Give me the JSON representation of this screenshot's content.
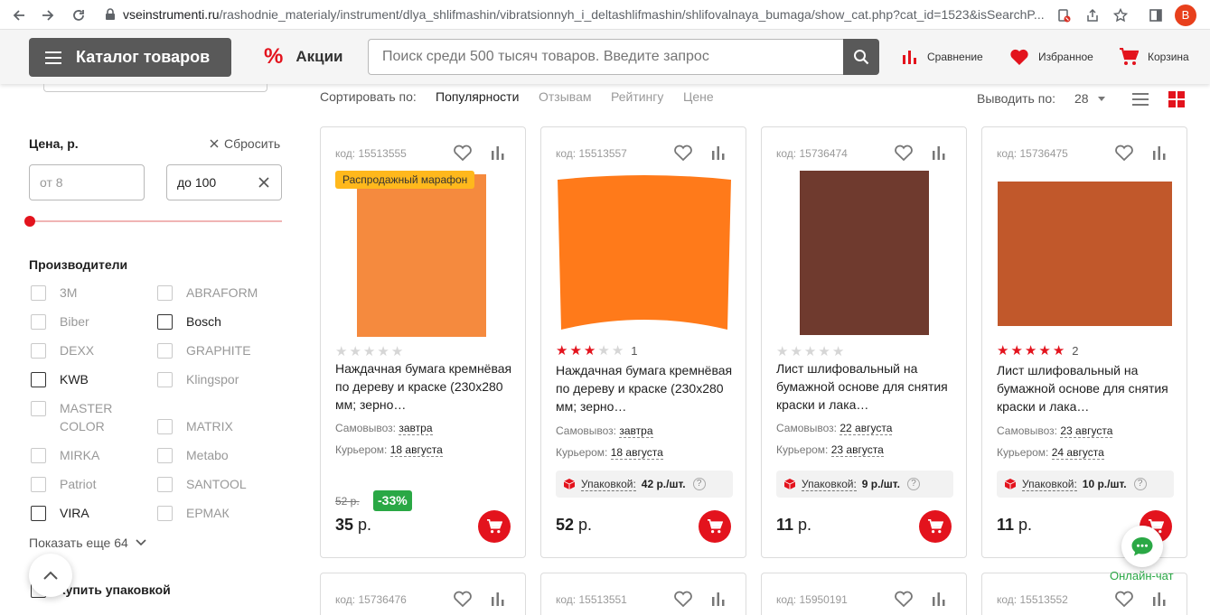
{
  "browser": {
    "url_host": "vseinstrumenti.ru",
    "url_path": "/rashodnie_materialy/instrument/dlya_shlifmashin/vibratsionnyh_i_deltashlifmashin/shlifovalnaya_bumaga/show_cat.php?cat_id=1523&isSearchP...",
    "avatar_letter": "B"
  },
  "header": {
    "catalog_label": "Каталог товаров",
    "promo_label": "Акции",
    "search_placeholder": "Поиск среди 500 тысяч товаров. Введите запрос",
    "compare_label": "Сравнение",
    "favorites_label": "Избранное",
    "cart_label": "Корзина"
  },
  "filters": {
    "price_title": "Цена, р.",
    "reset_label": "Сбросить",
    "price_from_placeholder": "от 8",
    "price_to_value": "до 100",
    "manufacturers_title": "Производители",
    "brands": [
      "3M",
      "ABRAFORM",
      "Biber",
      "Bosch",
      "DEXX",
      "GRAPHITE",
      "KWB",
      "Klingspor",
      "MASTER COLOR",
      "MATRIX",
      "MIRKA",
      "Metabo",
      "Patriot",
      "SANTOOL",
      "VIRA",
      "ЕРМАК"
    ],
    "show_more_label": "Показать еще 64",
    "buy_by_pack_label": "Купить упаковкой"
  },
  "sort": {
    "label": "Сортировать по:",
    "options": [
      "Популярности",
      "Отзывам",
      "Рейтингу",
      "Цене"
    ],
    "per_page_label": "Выводить по:",
    "per_page_value": "28"
  },
  "products": [
    {
      "code": "код: 15513555",
      "badge": "Распродажный марафон",
      "rating": 0,
      "reviews": "",
      "title": "Наждачная бумага кремнёвая по дереву и краске (230х280 мм; зерно…",
      "pickup_label": "Самовывоз:",
      "pickup_date": "завтра",
      "courier_label": "Курьером:",
      "courier_date": "18 августа",
      "old_price": "52 р.",
      "discount": "-33%",
      "price": "35",
      "currency": "р."
    },
    {
      "code": "код: 15513557",
      "rating": 3,
      "reviews": "1",
      "title": "Наждачная бумага кремнёвая по дереву и краске (230х280 мм; зерно…",
      "pickup_label": "Самовывоз:",
      "pickup_date": "завтра",
      "courier_label": "Курьером:",
      "courier_date": "18 августа",
      "pack_label": "Упаковкой:",
      "pack_price": "42 р./шт.",
      "price": "52",
      "currency": "р."
    },
    {
      "code": "код: 15736474",
      "rating": 0,
      "reviews": "",
      "title": "Лист шлифовальный на бумажной основе для снятия краски и лака…",
      "pickup_label": "Самовывоз:",
      "pickup_date": "22 августа",
      "courier_label": "Курьером:",
      "courier_date": "23 августа",
      "pack_label": "Упаковкой:",
      "pack_price": "9 р./шт.",
      "price": "11",
      "currency": "р."
    },
    {
      "code": "код: 15736475",
      "rating": 5,
      "reviews": "2",
      "title": "Лист шлифовальный на бумажной основе для снятия краски и лака…",
      "pickup_label": "Самовывоз:",
      "pickup_date": "23 августа",
      "courier_label": "Курьером:",
      "courier_date": "24 августа",
      "pack_label": "Упаковкой:",
      "pack_price": "10 р./шт.",
      "price": "11",
      "currency": "р."
    }
  ],
  "products_row2": [
    {
      "code": "код: 15736476"
    },
    {
      "code": "код: 15513551"
    },
    {
      "code": "код: 15950191"
    },
    {
      "code": "код: 15513552"
    }
  ],
  "chat": {
    "label": "Онлайн-чат"
  },
  "colors": {
    "accent": "#e3131d",
    "header_bg": "#f5f5f5",
    "catalog_btn": "#595959",
    "badge": "#ffb81c",
    "discount": "#2aa845",
    "chat": "#2aa845"
  }
}
